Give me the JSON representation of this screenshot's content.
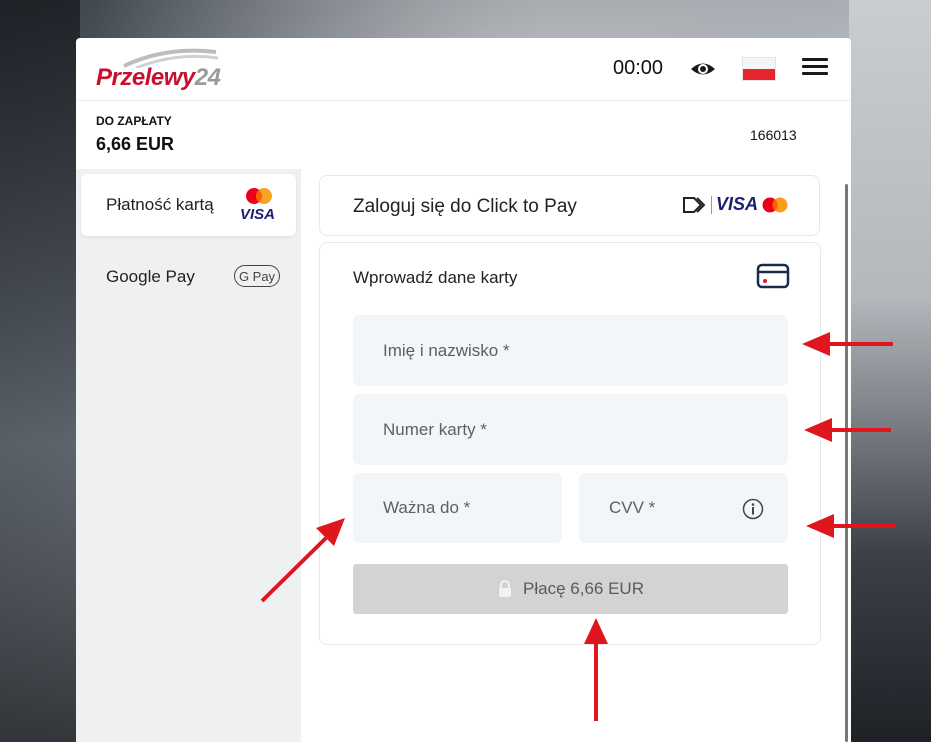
{
  "header": {
    "logo_main": "Przelewy",
    "logo_num": "24",
    "timer": "00:00",
    "eye_icon": "eye-icon",
    "flag": "poland-flag",
    "menu_icon": "hamburger-menu-icon"
  },
  "summary": {
    "amount_label": "DO ZAPŁATY",
    "amount_value": "6,66 EUR",
    "order_id": "166013"
  },
  "sidebar": {
    "items": [
      {
        "label": "Płatność kartą",
        "badge": "VISA",
        "active": true
      },
      {
        "label": "Google Pay",
        "badge": "G Pay",
        "active": false
      }
    ]
  },
  "click_to_pay": {
    "title": "Zaloguj się do Click to Pay",
    "visa": "VISA"
  },
  "card_form": {
    "title": "Wprowadź dane karty",
    "name_placeholder": "Imię i nazwisko *",
    "number_placeholder": "Numer karty *",
    "expiry_placeholder": "Ważna do *",
    "cvv_placeholder": "CVV *",
    "pay_button": "Płacę 6,66 EUR"
  },
  "colors": {
    "brand_red": "#c8102e",
    "visa_blue": "#1a1f71",
    "annotation_arrow": "#e0161e",
    "field_bg": "#f3f6f9",
    "button_disabled": "#d3d3d3"
  }
}
